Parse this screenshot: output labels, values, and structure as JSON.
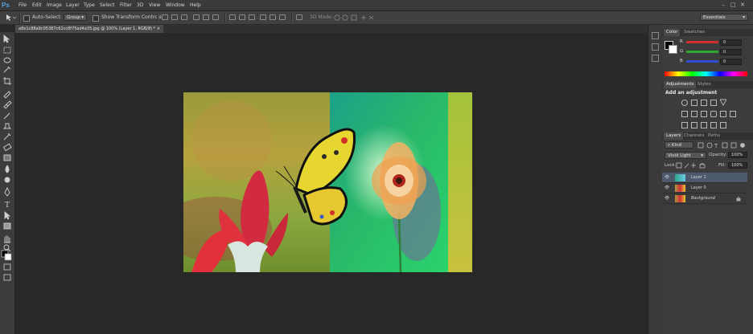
{
  "app": {
    "logo": "Ps"
  },
  "menu": [
    "File",
    "Edit",
    "Image",
    "Layer",
    "Type",
    "Select",
    "Filter",
    "3D",
    "View",
    "Window",
    "Help"
  ],
  "window_controls": {
    "minimize": "–",
    "maximize": "□",
    "close": "✕"
  },
  "options": {
    "auto_select_label": "Auto-Select:",
    "auto_select_value": "Group",
    "transform_label": "Show Transform Controls",
    "mode3d_label": "3D Mode:",
    "workspace": "Essentials"
  },
  "document": {
    "tab_title": "a8e1c88a9c05387c62cc8f75ad4a35.jpg @ 100% (Layer 1, RGB/8) *",
    "close": "×"
  },
  "color_panel": {
    "tabs": [
      "Color",
      "Swatches"
    ],
    "channels": [
      {
        "label": "R",
        "value": "0",
        "color": "#d23030"
      },
      {
        "label": "G",
        "value": "0",
        "color": "#2fa838"
      },
      {
        "label": "B",
        "value": "0",
        "color": "#2f4fd0"
      }
    ]
  },
  "adjustments_panel": {
    "tabs": [
      "Adjustments",
      "Styles"
    ],
    "heading": "Add an adjustment"
  },
  "layers_panel": {
    "tabs": [
      "Layers",
      "Channels",
      "Paths"
    ],
    "filter_kind": "Kind",
    "blend_mode": "Vivid Light",
    "opacity_label": "Opacity:",
    "opacity_value": "100%",
    "lock_label": "Lock:",
    "fill_label": "Fill:",
    "fill_value": "100%",
    "layers": [
      {
        "name": "Layer 1",
        "selected": true
      },
      {
        "name": "Layer 0",
        "selected": false
      },
      {
        "name": "Background",
        "selected": false,
        "locked": true
      }
    ]
  }
}
